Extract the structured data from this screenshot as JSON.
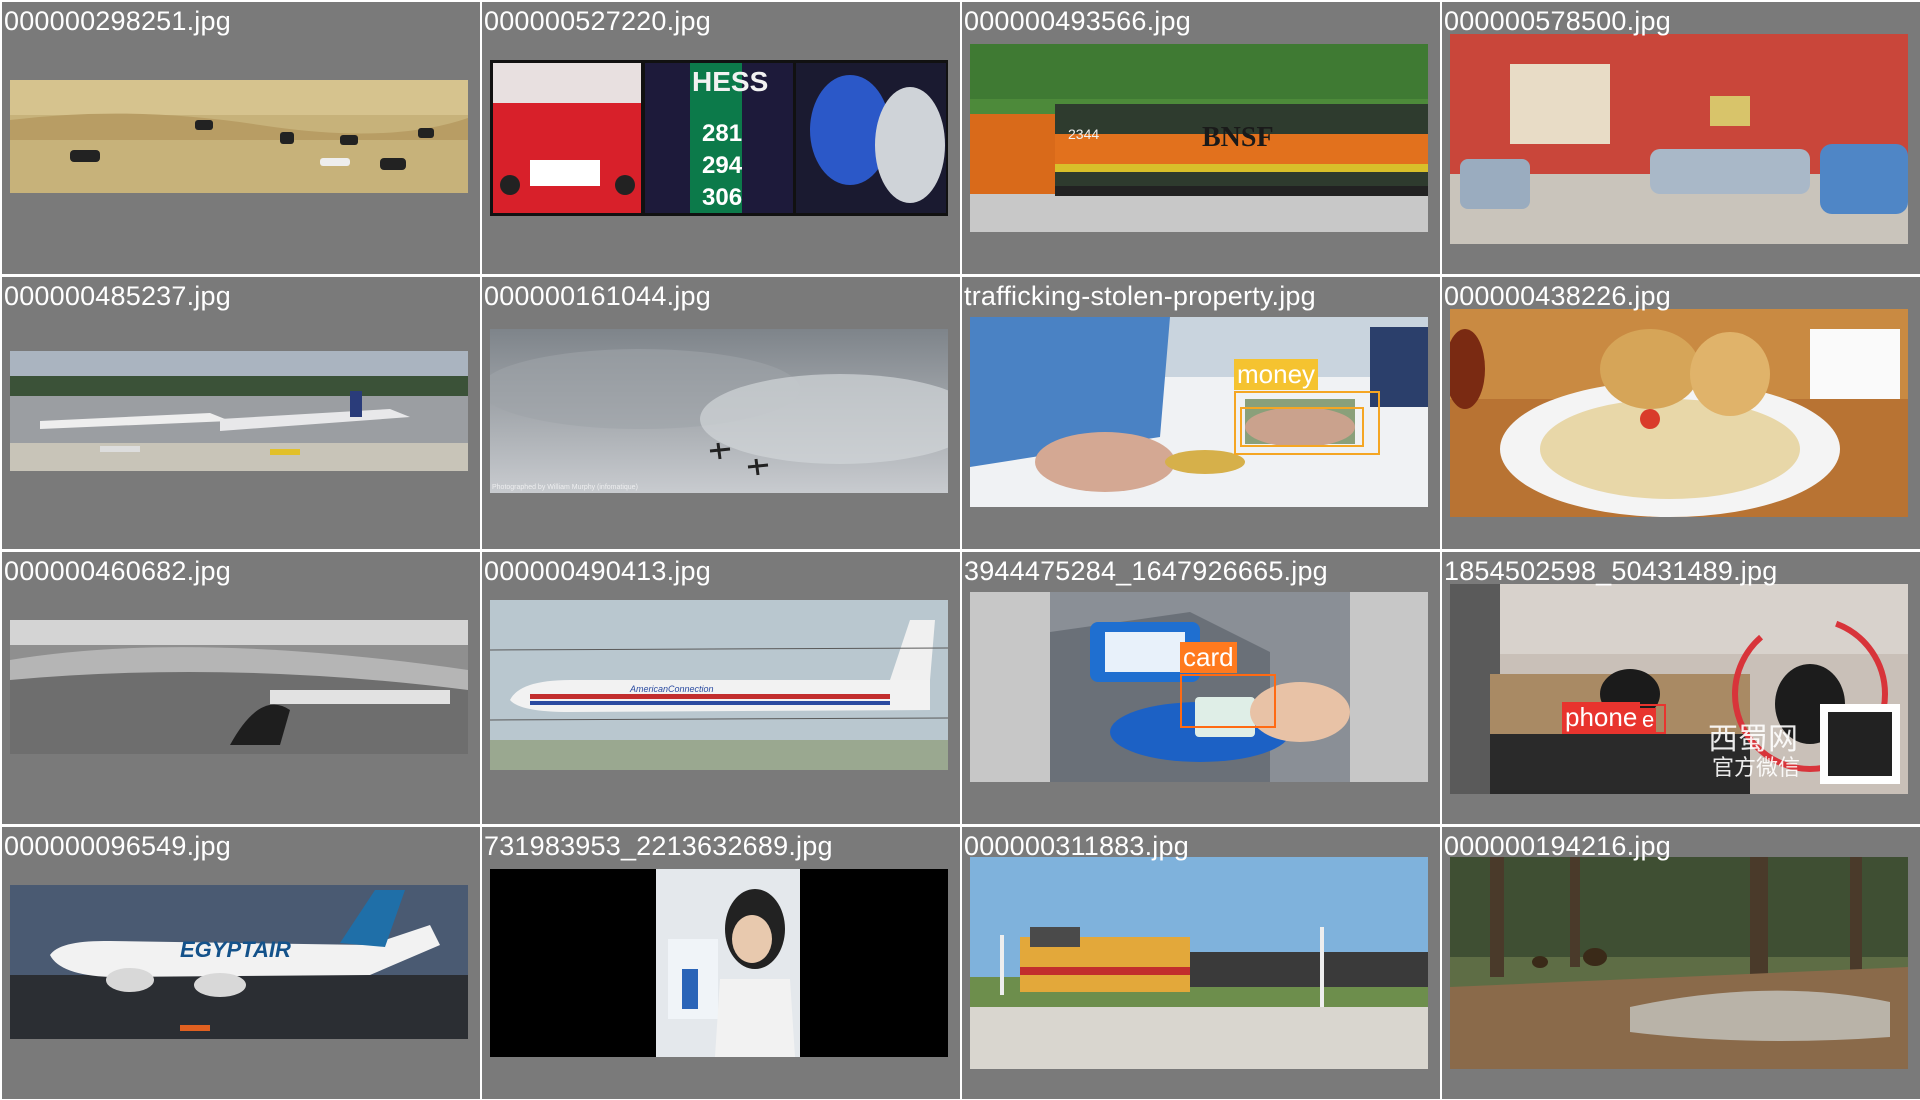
{
  "tiles": [
    {
      "filename": "000000298251.jpg"
    },
    {
      "filename": "000000527220.jpg",
      "sign_text": "HESS",
      "prices": [
        "281",
        "294",
        "306"
      ]
    },
    {
      "filename": "000000493566.jpg",
      "loco_text": "BNSF",
      "loco_number": "2344"
    },
    {
      "filename": "000000578500.jpg"
    },
    {
      "filename": "000000485237.jpg"
    },
    {
      "filename": "000000161044.jpg",
      "caption": "Photographed by William Murphy (infomatique)"
    },
    {
      "filename": "trafficking-stolen-property.jpg",
      "detections": [
        {
          "label": "money",
          "color": "#f5a623"
        }
      ]
    },
    {
      "filename": "000000438226.jpg"
    },
    {
      "filename": "000000460682.jpg"
    },
    {
      "filename": "000000490413.jpg",
      "livery_text": "AmericanConnection"
    },
    {
      "filename": "3944475284_1647926665.jpg",
      "detections": [
        {
          "label": "card",
          "color": "#ff6a13"
        }
      ]
    },
    {
      "filename": "1854502598_50431489.jpg",
      "detections": [
        {
          "label": "phone",
          "color": "#e8342e"
        }
      ],
      "extra_label": "e",
      "watermark": "西蜀网",
      "watermark_sub": "官方微信"
    },
    {
      "filename": "000000096549.jpg",
      "livery_text": "EGYPTAIR"
    },
    {
      "filename": "731983953_2213632689.jpg"
    },
    {
      "filename": "000000311883.jpg"
    },
    {
      "filename": "000000194216.jpg"
    }
  ],
  "colors": {
    "cell_bg": "#7a7a7a",
    "gutter": "#ffffff",
    "text": "#ffffff"
  }
}
